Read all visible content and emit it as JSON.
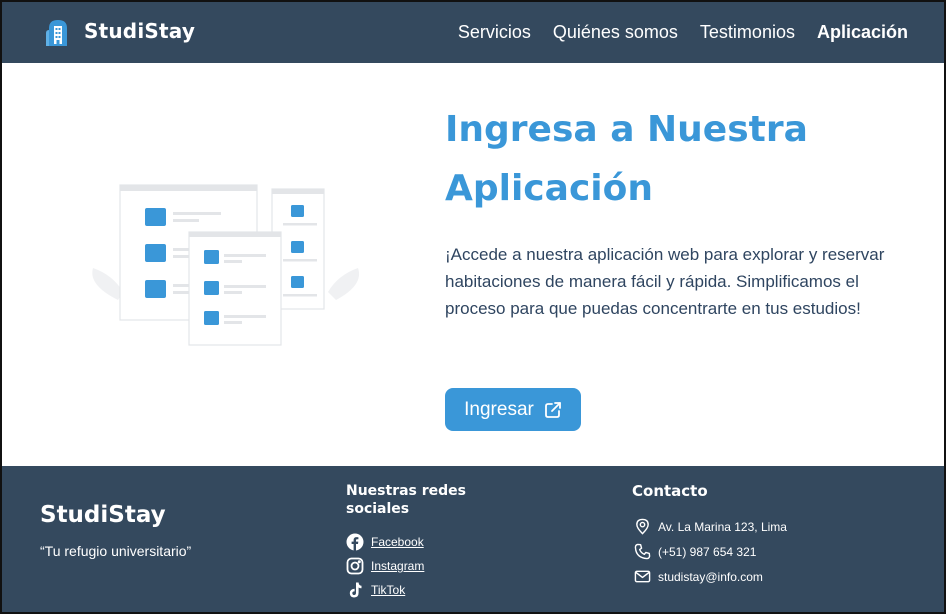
{
  "header": {
    "brand": "StudiStay",
    "nav": [
      "Servicios",
      "Quiénes somos",
      "Testimonios",
      "Aplicación"
    ],
    "active_nav": "Aplicación"
  },
  "hero": {
    "title_line1": "Ingresa a Nuestra",
    "title_line2": "Aplicación",
    "description": "¡Accede a nuestra aplicación web para explorar y reservar habitaciones de manera fácil y rápida. Simplificamos el proceso para que puedas concentrarte en tus estudios!",
    "button_label": "Ingresar",
    "button_icon": "external-link-icon",
    "illustration": "app-windows-illustration"
  },
  "footer": {
    "brand": "StudiStay",
    "tagline": "“Tu refugio universitario”",
    "social_title": "Nuestras redes sociales",
    "social_links": [
      {
        "label": "Facebook",
        "icon": "facebook-icon"
      },
      {
        "label": "Instagram",
        "icon": "instagram-icon"
      },
      {
        "label": "TikTok",
        "icon": "tiktok-icon"
      }
    ],
    "contact_title": "Contacto",
    "contact": [
      {
        "text": "Av. La Marina 123, Lima",
        "icon": "location-pin-icon"
      },
      {
        "text": "(+51) 987 654 321",
        "icon": "phone-icon"
      },
      {
        "text": "studistay@info.com",
        "icon": "mail-icon"
      }
    ]
  },
  "colors": {
    "header_bg": "#34495e",
    "footer_bg": "#34495e",
    "accent": "#3a97d8",
    "text": "#2f4560"
  }
}
